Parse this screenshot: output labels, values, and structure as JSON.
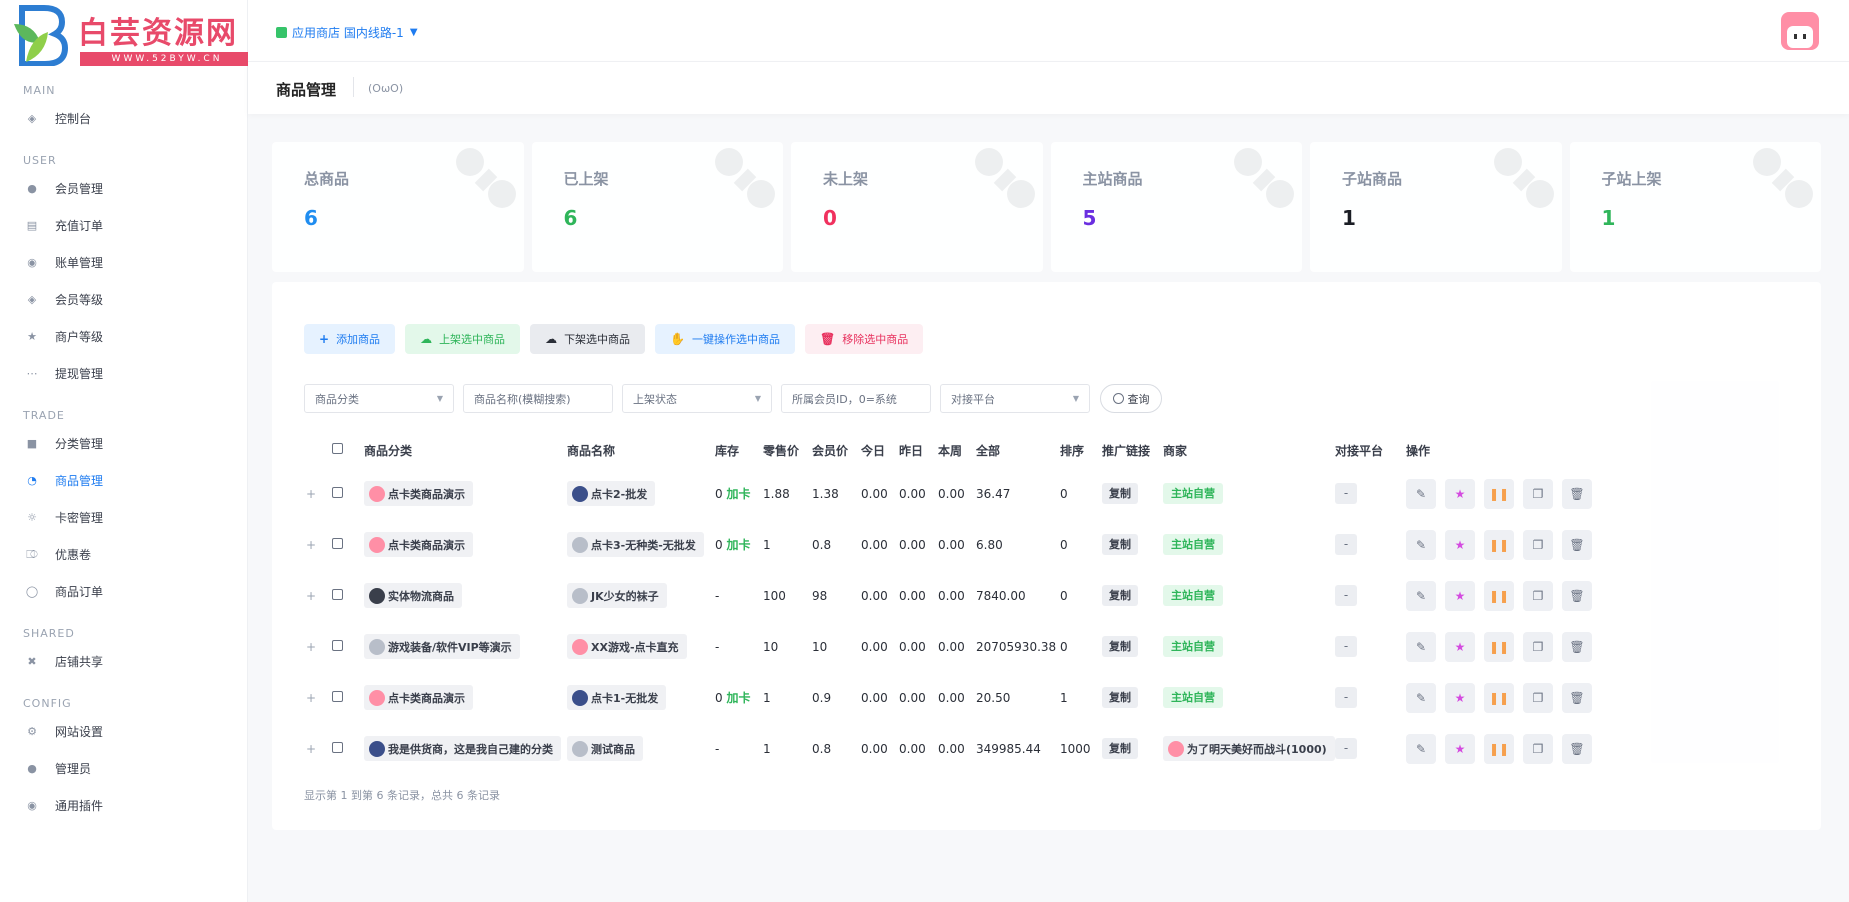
{
  "logo": {
    "name": "白芸资源网",
    "url": "WWW.52BYW.CN"
  },
  "topbar": {
    "store_label": "应用商店",
    "route": "国内线路-1"
  },
  "sidebar": {
    "sections": [
      {
        "title": "MAIN",
        "items": [
          {
            "label": "控制台",
            "icon": "dashboard-icon"
          }
        ]
      },
      {
        "title": "USER",
        "items": [
          {
            "label": "会员管理",
            "icon": "user-icon"
          },
          {
            "label": "充值订单",
            "icon": "recharge-icon"
          },
          {
            "label": "账单管理",
            "icon": "bill-icon"
          },
          {
            "label": "会员等级",
            "icon": "level-icon"
          },
          {
            "label": "商户等级",
            "icon": "merchant-icon"
          },
          {
            "label": "提现管理",
            "icon": "withdraw-icon"
          }
        ]
      },
      {
        "title": "TRADE",
        "items": [
          {
            "label": "分类管理",
            "icon": "category-icon"
          },
          {
            "label": "商品管理",
            "icon": "goods-icon",
            "active": true
          },
          {
            "label": "卡密管理",
            "icon": "card-icon"
          },
          {
            "label": "优惠卷",
            "icon": "coupon-icon"
          },
          {
            "label": "商品订单",
            "icon": "order-icon"
          }
        ]
      },
      {
        "title": "SHARED",
        "items": [
          {
            "label": "店铺共享",
            "icon": "share-icon"
          }
        ]
      },
      {
        "title": "CONFIG",
        "items": [
          {
            "label": "网站设置",
            "icon": "settings-icon"
          },
          {
            "label": "管理员",
            "icon": "admin-icon"
          },
          {
            "label": "通用插件",
            "icon": "plugin-icon"
          }
        ]
      }
    ]
  },
  "page": {
    "title": "商品管理",
    "emoticon": "(OωO)"
  },
  "stats": [
    {
      "label": "总商品",
      "value": "6",
      "color": "#1f8df0"
    },
    {
      "label": "已上架",
      "value": "6",
      "color": "#2fb55a"
    },
    {
      "label": "未上架",
      "value": "0",
      "color": "#f0315e"
    },
    {
      "label": "主站商品",
      "value": "5",
      "color": "#6a2ee0"
    },
    {
      "label": "子站商品",
      "value": "1",
      "color": "#1a1d24"
    },
    {
      "label": "子站上架",
      "value": "1",
      "color": "#2fb55a"
    }
  ],
  "toolbar": {
    "add": "添加商品",
    "shelve": "上架选中商品",
    "unshelve": "下架选中商品",
    "batch": "一键操作选中商品",
    "remove": "移除选中商品"
  },
  "filters": {
    "category": "商品分类",
    "name_placeholder": "商品名称(模糊搜索)",
    "status": "上架状态",
    "member_placeholder": "所属会员ID，0=系统",
    "platform": "对接平台",
    "query": "查询"
  },
  "table": {
    "headers": [
      "商品分类",
      "商品名称",
      "库存",
      "零售价",
      "会员价",
      "今日",
      "昨日",
      "本周",
      "全部",
      "排序",
      "推广链接",
      "商家",
      "对接平台",
      "操作"
    ],
    "rows": [
      {
        "category": "点卡类商品演示",
        "cat_av": "pink",
        "name": "点卡2-批发",
        "name_av": "blue",
        "stock": "0",
        "stock_tag": "加卡",
        "retail": "1.88",
        "member": "1.38",
        "today": "0.00",
        "yesterday": "0.00",
        "week": "0.00",
        "total": "36.47",
        "sort": "0",
        "link": "复制",
        "merchant": "主站自营",
        "merchant_type": "self",
        "platform": "-"
      },
      {
        "category": "点卡类商品演示",
        "cat_av": "pink",
        "name": "点卡3-无种类-无批发",
        "name_av": "gray",
        "stock": "0",
        "stock_tag": "加卡",
        "retail": "1",
        "member": "0.8",
        "today": "0.00",
        "yesterday": "0.00",
        "week": "0.00",
        "total": "6.80",
        "sort": "0",
        "link": "复制",
        "merchant": "主站自营",
        "merchant_type": "self",
        "platform": "-"
      },
      {
        "category": "实体物流商品",
        "cat_av": "dark",
        "name": "JK少女的袜子",
        "name_av": "gray",
        "stock": "-",
        "stock_tag": "",
        "retail": "100",
        "member": "98",
        "today": "0.00",
        "yesterday": "0.00",
        "week": "0.00",
        "total": "7840.00",
        "sort": "0",
        "link": "复制",
        "merchant": "主站自营",
        "merchant_type": "self",
        "platform": "-"
      },
      {
        "category": "游戏装备/软件VIP等演示",
        "cat_av": "gray",
        "name": "XX游戏-点卡直充",
        "name_av": "pink",
        "stock": "-",
        "stock_tag": "",
        "retail": "10",
        "member": "10",
        "today": "0.00",
        "yesterday": "0.00",
        "week": "0.00",
        "total": "20705930.38",
        "sort": "0",
        "link": "复制",
        "merchant": "主站自营",
        "merchant_type": "self",
        "platform": "-"
      },
      {
        "category": "点卡类商品演示",
        "cat_av": "pink",
        "name": "点卡1-无批发",
        "name_av": "blue",
        "stock": "0",
        "stock_tag": "加卡",
        "retail": "1",
        "member": "0.9",
        "today": "0.00",
        "yesterday": "0.00",
        "week": "0.00",
        "total": "20.50",
        "sort": "1",
        "link": "复制",
        "merchant": "主站自营",
        "merchant_type": "self",
        "platform": "-"
      },
      {
        "category": "我是供货商，这是我自己建的分类",
        "cat_av": "blue",
        "name": "测试商品",
        "name_av": "gray",
        "stock": "-",
        "stock_tag": "",
        "retail": "1",
        "member": "0.8",
        "today": "0.00",
        "yesterday": "0.00",
        "week": "0.00",
        "total": "349985.44",
        "sort": "1000",
        "link": "复制",
        "merchant": "为了明天美好而战斗(1000)",
        "merchant_type": "user",
        "platform": "-"
      }
    ]
  },
  "pagination": "显示第 1 到第 6 条记录，总共 6 条记录"
}
